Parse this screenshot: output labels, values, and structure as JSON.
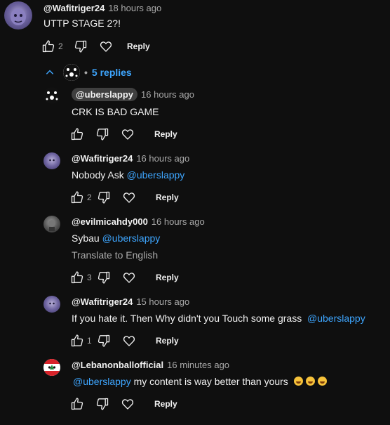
{
  "colors": {
    "background": "#0f0f0f",
    "link": "#3ea6ff",
    "muted": "#aaaaaa",
    "text": "#f1f1f1"
  },
  "top_comment": {
    "author": "@Wafitriger24",
    "time": "18 hours ago",
    "text": "UTTP STAGE 2?!",
    "likes": "2",
    "reply_label": "Reply"
  },
  "replies_toggle": {
    "bullet": "•",
    "label": "5 replies",
    "icon": "chevron-up-icon"
  },
  "replies": [
    {
      "author": "@uberslappy",
      "time": "16 hours ago",
      "text": "CRK IS BAD GAME",
      "likes": "",
      "reply_label": "Reply"
    },
    {
      "author": "@Wafitriger24",
      "time": "16 hours ago",
      "text": "Nobody Ask",
      "mention": "@uberslappy",
      "likes": "2",
      "reply_label": "Reply"
    },
    {
      "author": "@evilmicahdy000",
      "time": "16 hours ago",
      "text": "Sybau",
      "mention": "@uberslappy",
      "translate": "Translate to English",
      "likes": "3",
      "reply_label": "Reply"
    },
    {
      "author": "@Wafitriger24",
      "time": "15 hours ago",
      "text": "If you hate it. Then Why didn't you Touch some grass",
      "mention": "@uberslappy",
      "likes": "1",
      "reply_label": "Reply"
    },
    {
      "author": "@Lebanonballofficial",
      "time": "16 minutes ago",
      "mention": "@uberslappy",
      "text": "my content is way better than yours",
      "emojis": [
        "rofl-emoji",
        "rofl-emoji",
        "rofl-emoji"
      ],
      "likes": "",
      "reply_label": "Reply"
    }
  ]
}
